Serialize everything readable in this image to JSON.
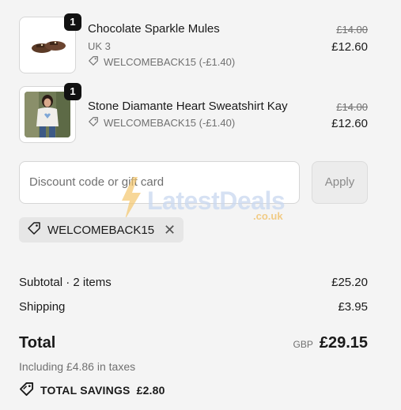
{
  "items": [
    {
      "quantity": "1",
      "name": "Chocolate Sparkle Mules",
      "variant": "UK 3",
      "discount": "WELCOMEBACK15 (-£1.40)",
      "original_price": "£14.00",
      "price": "£12.60",
      "image_icon": "shoe-mule-thumbnail"
    },
    {
      "quantity": "1",
      "name": "Stone Diamante Heart Sweatshirt Kay",
      "variant": "",
      "discount": "WELCOMEBACK15 (-£1.40)",
      "original_price": "£14.00",
      "price": "£12.60",
      "image_icon": "sweatshirt-model-thumbnail"
    }
  ],
  "discount_form": {
    "placeholder": "Discount code or gift card",
    "apply_label": "Apply"
  },
  "applied_code": {
    "code": "WELCOMEBACK15",
    "remove_icon": "close-icon"
  },
  "summary": {
    "subtotal_label": "Subtotal · 2 items",
    "subtotal_value": "£25.20",
    "shipping_label": "Shipping",
    "shipping_value": "£3.95",
    "total_label": "Total",
    "currency": "GBP",
    "total_value": "£29.15",
    "taxes_note": "Including £4.86 in taxes",
    "savings_label": "TOTAL SAVINGS",
    "savings_value": "£2.80"
  },
  "watermark": {
    "text": "LatestDeals",
    "sub": ".co.uk"
  },
  "colors": {
    "background": "#f4f4f4",
    "text": "#1a1a1a",
    "muted": "#707070",
    "badge": "#111111"
  }
}
